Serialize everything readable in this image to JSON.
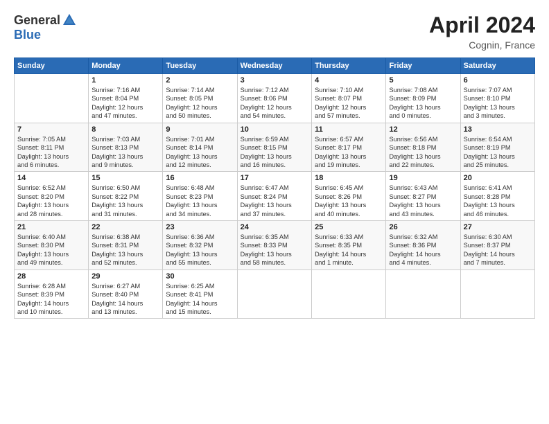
{
  "header": {
    "logo_general": "General",
    "logo_blue": "Blue",
    "month_year": "April 2024",
    "location": "Cognin, France"
  },
  "days_of_week": [
    "Sunday",
    "Monday",
    "Tuesday",
    "Wednesday",
    "Thursday",
    "Friday",
    "Saturday"
  ],
  "weeks": [
    [
      {
        "day": "",
        "info": ""
      },
      {
        "day": "1",
        "info": "Sunrise: 7:16 AM\nSunset: 8:04 PM\nDaylight: 12 hours\nand 47 minutes."
      },
      {
        "day": "2",
        "info": "Sunrise: 7:14 AM\nSunset: 8:05 PM\nDaylight: 12 hours\nand 50 minutes."
      },
      {
        "day": "3",
        "info": "Sunrise: 7:12 AM\nSunset: 8:06 PM\nDaylight: 12 hours\nand 54 minutes."
      },
      {
        "day": "4",
        "info": "Sunrise: 7:10 AM\nSunset: 8:07 PM\nDaylight: 12 hours\nand 57 minutes."
      },
      {
        "day": "5",
        "info": "Sunrise: 7:08 AM\nSunset: 8:09 PM\nDaylight: 13 hours\nand 0 minutes."
      },
      {
        "day": "6",
        "info": "Sunrise: 7:07 AM\nSunset: 8:10 PM\nDaylight: 13 hours\nand 3 minutes."
      }
    ],
    [
      {
        "day": "7",
        "info": "Sunrise: 7:05 AM\nSunset: 8:11 PM\nDaylight: 13 hours\nand 6 minutes."
      },
      {
        "day": "8",
        "info": "Sunrise: 7:03 AM\nSunset: 8:13 PM\nDaylight: 13 hours\nand 9 minutes."
      },
      {
        "day": "9",
        "info": "Sunrise: 7:01 AM\nSunset: 8:14 PM\nDaylight: 13 hours\nand 12 minutes."
      },
      {
        "day": "10",
        "info": "Sunrise: 6:59 AM\nSunset: 8:15 PM\nDaylight: 13 hours\nand 16 minutes."
      },
      {
        "day": "11",
        "info": "Sunrise: 6:57 AM\nSunset: 8:17 PM\nDaylight: 13 hours\nand 19 minutes."
      },
      {
        "day": "12",
        "info": "Sunrise: 6:56 AM\nSunset: 8:18 PM\nDaylight: 13 hours\nand 22 minutes."
      },
      {
        "day": "13",
        "info": "Sunrise: 6:54 AM\nSunset: 8:19 PM\nDaylight: 13 hours\nand 25 minutes."
      }
    ],
    [
      {
        "day": "14",
        "info": "Sunrise: 6:52 AM\nSunset: 8:20 PM\nDaylight: 13 hours\nand 28 minutes."
      },
      {
        "day": "15",
        "info": "Sunrise: 6:50 AM\nSunset: 8:22 PM\nDaylight: 13 hours\nand 31 minutes."
      },
      {
        "day": "16",
        "info": "Sunrise: 6:48 AM\nSunset: 8:23 PM\nDaylight: 13 hours\nand 34 minutes."
      },
      {
        "day": "17",
        "info": "Sunrise: 6:47 AM\nSunset: 8:24 PM\nDaylight: 13 hours\nand 37 minutes."
      },
      {
        "day": "18",
        "info": "Sunrise: 6:45 AM\nSunset: 8:26 PM\nDaylight: 13 hours\nand 40 minutes."
      },
      {
        "day": "19",
        "info": "Sunrise: 6:43 AM\nSunset: 8:27 PM\nDaylight: 13 hours\nand 43 minutes."
      },
      {
        "day": "20",
        "info": "Sunrise: 6:41 AM\nSunset: 8:28 PM\nDaylight: 13 hours\nand 46 minutes."
      }
    ],
    [
      {
        "day": "21",
        "info": "Sunrise: 6:40 AM\nSunset: 8:30 PM\nDaylight: 13 hours\nand 49 minutes."
      },
      {
        "day": "22",
        "info": "Sunrise: 6:38 AM\nSunset: 8:31 PM\nDaylight: 13 hours\nand 52 minutes."
      },
      {
        "day": "23",
        "info": "Sunrise: 6:36 AM\nSunset: 8:32 PM\nDaylight: 13 hours\nand 55 minutes."
      },
      {
        "day": "24",
        "info": "Sunrise: 6:35 AM\nSunset: 8:33 PM\nDaylight: 13 hours\nand 58 minutes."
      },
      {
        "day": "25",
        "info": "Sunrise: 6:33 AM\nSunset: 8:35 PM\nDaylight: 14 hours\nand 1 minute."
      },
      {
        "day": "26",
        "info": "Sunrise: 6:32 AM\nSunset: 8:36 PM\nDaylight: 14 hours\nand 4 minutes."
      },
      {
        "day": "27",
        "info": "Sunrise: 6:30 AM\nSunset: 8:37 PM\nDaylight: 14 hours\nand 7 minutes."
      }
    ],
    [
      {
        "day": "28",
        "info": "Sunrise: 6:28 AM\nSunset: 8:39 PM\nDaylight: 14 hours\nand 10 minutes."
      },
      {
        "day": "29",
        "info": "Sunrise: 6:27 AM\nSunset: 8:40 PM\nDaylight: 14 hours\nand 13 minutes."
      },
      {
        "day": "30",
        "info": "Sunrise: 6:25 AM\nSunset: 8:41 PM\nDaylight: 14 hours\nand 15 minutes."
      },
      {
        "day": "",
        "info": ""
      },
      {
        "day": "",
        "info": ""
      },
      {
        "day": "",
        "info": ""
      },
      {
        "day": "",
        "info": ""
      }
    ]
  ]
}
